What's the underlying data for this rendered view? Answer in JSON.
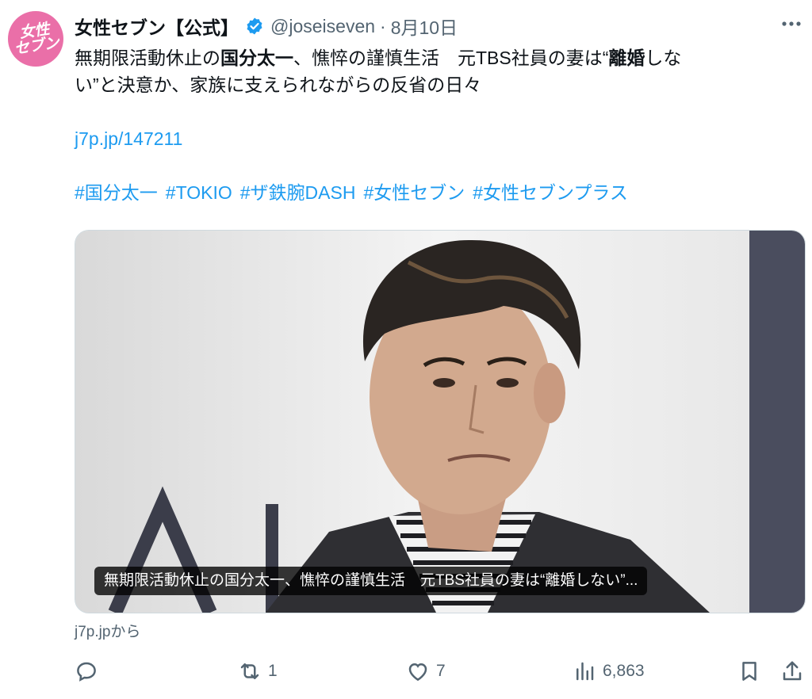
{
  "account": {
    "avatar_text": "女性セブン",
    "display_name": "女性セブン【公式】",
    "handle": "@joseiseven",
    "separator": "·",
    "date": "8月10日"
  },
  "post": {
    "line1_a": "無期限活動休止の",
    "line1_b": "国分太一",
    "line1_c": "、憔悴の謹慎生活　元TBS社員の妻は“",
    "line1_d": "離婚",
    "line1_e": "しな",
    "line2": "い”と決意か、家族に支えられながらの反省の日々",
    "link": "j7p.jp/147211",
    "hashtags": [
      "#国分太一",
      "#TOKIO",
      "#ザ鉄腕DASH",
      "#女性セブン",
      "#女性セブンプラス"
    ]
  },
  "card": {
    "caption": "無期限活動休止の国分太一、憔悴の謹慎生活　元TBS社員の妻は“離婚しない”..."
  },
  "source": "j7p.jpから",
  "actions": {
    "reply_count": "",
    "repost_count": "1",
    "like_count": "7",
    "views_count": "6,863"
  },
  "colors": {
    "accent": "#1d9bf0",
    "avatar_bg": "#ea6fa8",
    "muted": "#536471"
  },
  "icons": [
    "verified-badge-icon",
    "more-icon",
    "reply-icon",
    "repost-icon",
    "like-icon",
    "views-icon",
    "bookmark-icon",
    "share-icon"
  ]
}
